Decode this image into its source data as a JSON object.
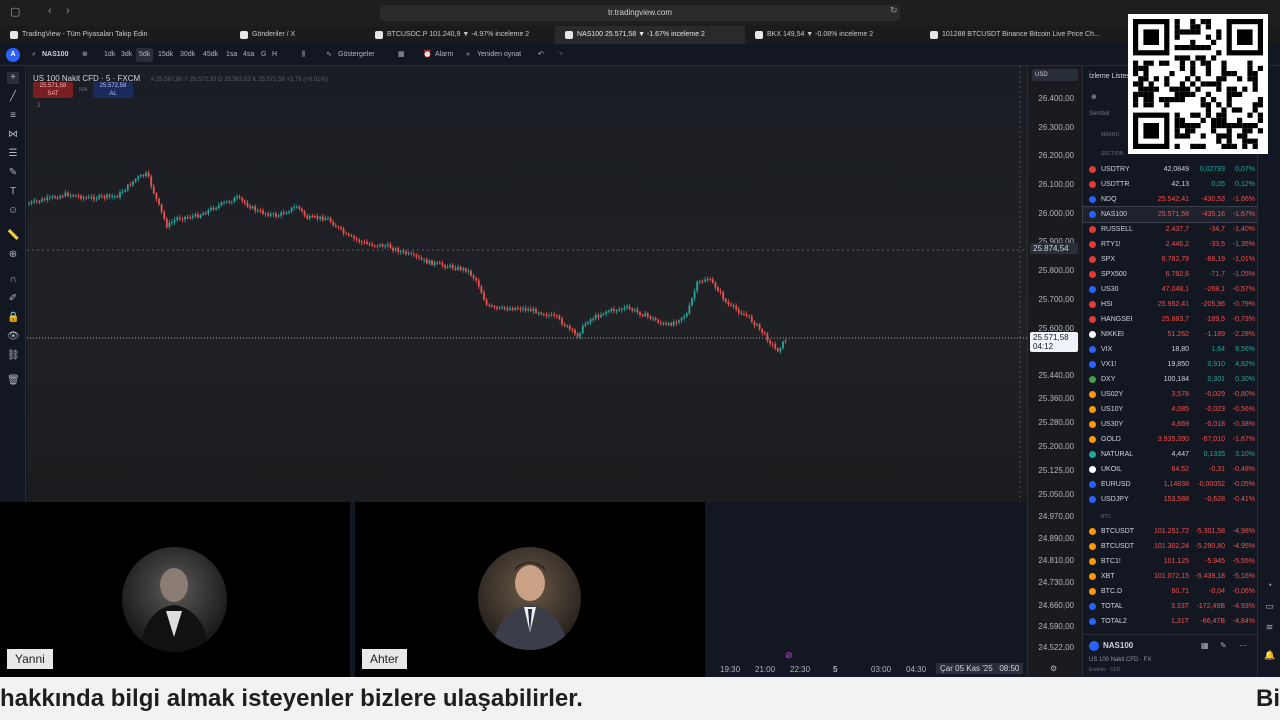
{
  "browser": {
    "url": "tr.tradingview.com",
    "tabs": [
      {
        "label": "TradingView - Tüm Piyasaları Takip Edin",
        "active": false
      },
      {
        "label": "Gönderiler / X",
        "active": false
      },
      {
        "label": "BTCUSDC.P 101.240,9 ▼ -4.97% inceleme 2",
        "active": false
      },
      {
        "label": "NAS100 25.571,58 ▼ -1.67% inceleme 2",
        "active": true
      },
      {
        "label": "BKX 149,54 ▼ -0.08% inceleme 2",
        "active": false
      },
      {
        "label": "101288 BTCUSDT Binance Bitcoin Live Price Ch...",
        "active": false
      }
    ]
  },
  "toolbar": {
    "symbol": "NAS100",
    "intervals": [
      "1dk",
      "3dk",
      "5dk",
      "15dk",
      "30dk",
      "45dk",
      "1sa",
      "4sa",
      "G",
      "H"
    ],
    "selected_interval": "5dk",
    "indicators_label": "Göstergeler",
    "alarm_label": "Alarm",
    "replay_label": "Yeniden oynat"
  },
  "chart": {
    "symbol_title": "US 100 Nakit CFD · 5 · FXCM",
    "ohlc": "A 25.587,80  Y 25.572,33  D 25.562,83  K 25.571,58  +3,76 (+0.01%)",
    "sell_price": "25.571,58",
    "sell_label": "SAT",
    "spread": "N/A",
    "buy_price": "25.572,58",
    "buy_label": "AL",
    "indicator_count": "3",
    "currency": "USD",
    "price_labels": [
      "26.400,00",
      "26.300,00",
      "26.200,00",
      "26.100,00",
      "26.000,00",
      "25.900,00",
      "25.800,00",
      "25.700,00",
      "25.600,00",
      "25.440,00",
      "25.360,00",
      "25.280,00",
      "25.200,00",
      "25.125,00",
      "25.050,00",
      "24.970,00",
      "24.890,00",
      "24.810,00",
      "24.730,00",
      "24.660,00",
      "24.590,00",
      "24.522,00"
    ],
    "crosshair_price": "25.874,54",
    "last_price": "25.571,58",
    "countdown": "04:12",
    "time_labels": [
      "19:30",
      "21:00",
      "22:30",
      "5",
      "03:00",
      "04:30"
    ],
    "date_tag": "Çar 05 Kas '25",
    "date_time": "08:50"
  },
  "cams": {
    "left_name": "Yanni",
    "right_name": "Ahter"
  },
  "watchlist": {
    "title": "İzleme Listesi",
    "col_symbol": "Sembol",
    "section_makro": "MAKRO",
    "section_main": "SECTION",
    "rows": [
      {
        "sym": "USDTRY",
        "last": "42,0849",
        "chg": "0,02793",
        "pct": "0,07%",
        "dir": "up",
        "color": "#e53935"
      },
      {
        "sym": "USDTTR",
        "last": "42,13",
        "chg": "0,05",
        "pct": "0,12%",
        "dir": "up",
        "color": "#e53935"
      },
      {
        "sym": "NDQ",
        "last": "25.542,41",
        "chg": "-430,53",
        "pct": "-1,66%",
        "dir": "down",
        "color": "#2962ff"
      },
      {
        "sym": "NAS100",
        "last": "25.571,58",
        "chg": "-435,16",
        "pct": "-1,67%",
        "dir": "down",
        "color": "#2962ff"
      },
      {
        "sym": "RUSSELL",
        "last": "2.437,7",
        "chg": "-34,7",
        "pct": "-1,40%",
        "dir": "down",
        "color": "#e53935"
      },
      {
        "sym": "RTY1!",
        "last": "2.446,2",
        "chg": "-33,5",
        "pct": "-1,35%",
        "dir": "down",
        "color": "#e53935"
      },
      {
        "sym": "SPX",
        "last": "6.782,79",
        "chg": "-69,19",
        "pct": "-1,01%",
        "dir": "down",
        "color": "#e53935"
      },
      {
        "sym": "SPX500",
        "last": "6.782,6",
        "chg": "-71,7",
        "pct": "-1,05%",
        "dir": "down",
        "color": "#e53935"
      },
      {
        "sym": "US30",
        "last": "47.048,1",
        "chg": "-268,1",
        "pct": "-0,57%",
        "dir": "down",
        "color": "#2962ff"
      },
      {
        "sym": "HSI",
        "last": "25.952,41",
        "chg": "-205,96",
        "pct": "-0,79%",
        "dir": "down",
        "color": "#e53935"
      },
      {
        "sym": "HANGSEI",
        "last": "25.883,7",
        "chg": "-189,5",
        "pct": "-0,73%",
        "dir": "down",
        "color": "#e53935"
      },
      {
        "sym": "NIKKEI",
        "last": "51.262",
        "chg": "-1.189",
        "pct": "-2,28%",
        "dir": "down",
        "color": "#ffffff"
      },
      {
        "sym": "VIX",
        "last": "18,80",
        "chg": "1,64",
        "pct": "9,56%",
        "dir": "up",
        "color": "#2962ff"
      },
      {
        "sym": "VX1!",
        "last": "19,850",
        "chg": "0,910",
        "pct": "4,82%",
        "dir": "up",
        "color": "#2962ff"
      },
      {
        "sym": "DXY",
        "last": "100,184",
        "chg": "0,301",
        "pct": "0,30%",
        "dir": "up",
        "color": "#43a047"
      },
      {
        "sym": "US02Y",
        "last": "3,578",
        "chg": "-0,029",
        "pct": "-0,80%",
        "dir": "down",
        "color": "#ff9800"
      },
      {
        "sym": "US10Y",
        "last": "4,085",
        "chg": "-0,023",
        "pct": "-0,56%",
        "dir": "down",
        "color": "#ff9800"
      },
      {
        "sym": "US30Y",
        "last": "4,669",
        "chg": "-0,018",
        "pct": "-0,38%",
        "dir": "down",
        "color": "#ff9800"
      },
      {
        "sym": "GOLD",
        "last": "3.935,390",
        "chg": "-67,010",
        "pct": "-1,67%",
        "dir": "down",
        "color": "#ff9800"
      },
      {
        "sym": "NATURAL",
        "last": "4,447",
        "chg": "0,1335",
        "pct": "3,10%",
        "dir": "up",
        "color": "#26a69a"
      },
      {
        "sym": "UKOIL",
        "last": "64,52",
        "chg": "-0,31",
        "pct": "-0,48%",
        "dir": "down",
        "color": "#ffffff"
      },
      {
        "sym": "EURUSD",
        "last": "1,14838",
        "chg": "-0,00052",
        "pct": "-0,05%",
        "dir": "down",
        "color": "#2962ff"
      },
      {
        "sym": "USDJPY",
        "last": "153,588",
        "chg": "-0,628",
        "pct": "-0,41%",
        "dir": "down",
        "color": "#2962ff"
      }
    ],
    "section_btc": "BTC",
    "btc_rows": [
      {
        "sym": "BTCUSDT",
        "last": "101.251,72",
        "chg": "-5.301,58",
        "pct": "-4,98%",
        "dir": "down",
        "color": "#ff9800"
      },
      {
        "sym": "BTCUSDT",
        "last": "101.302,24",
        "chg": "-5.290,80",
        "pct": "-4,95%",
        "dir": "down",
        "color": "#ff9800"
      },
      {
        "sym": "BTC1!",
        "last": "101.125",
        "chg": "-5.945",
        "pct": "-5,55%",
        "dir": "down",
        "color": "#ff9800"
      },
      {
        "sym": "XBT",
        "last": "101.072,15",
        "chg": "-5.439,18",
        "pct": "-5,16%",
        "dir": "down",
        "color": "#ff9800"
      },
      {
        "sym": "BTC.D",
        "last": "60,71",
        "chg": "-0,04",
        "pct": "-0,06%",
        "dir": "down",
        "color": "#ff9800"
      },
      {
        "sym": "TOTAL",
        "last": "3,33T",
        "chg": "-172,49B",
        "pct": "-4,93%",
        "dir": "down",
        "color": "#2962ff"
      },
      {
        "sym": "TOTAL2",
        "last": "1,31T",
        "chg": "-66,47B",
        "pct": "-4,84%",
        "dir": "down",
        "color": "#2962ff"
      }
    ],
    "detail_symbol": "NAS100",
    "detail_name": "US 100 Nakit CFD · FX",
    "detail_sub": "Endeks · CFD"
  },
  "colors": {
    "up": "#26a69a",
    "down": "#ef5350",
    "accent": "#2962ff"
  },
  "caption": {
    "text": "hakkında bilgi almak isteyenler bizlere ulaşabilirler.",
    "tail": "Bi"
  }
}
